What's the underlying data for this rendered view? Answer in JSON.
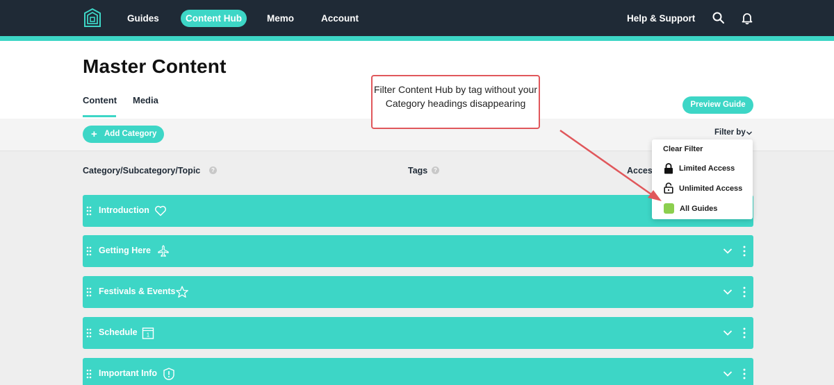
{
  "nav": {
    "logo": "house-logo",
    "items": [
      {
        "label": "Guides"
      },
      {
        "label": "Content Hub"
      },
      {
        "label": "Memo"
      },
      {
        "label": "Account"
      }
    ],
    "help_label": "Help & Support",
    "search_icon": "search-icon",
    "bell_icon": "bell-icon",
    "accent_color": "#3dd6c6",
    "bg_color": "#1f2a36"
  },
  "page": {
    "title": "Master Content",
    "tabs": [
      {
        "label": "Content"
      },
      {
        "label": "Media"
      }
    ],
    "preview_button": "Preview Guide"
  },
  "toolbar": {
    "add_category": "+ Add Category",
    "add_category_text": "Add Category",
    "filter_by": "Filter by"
  },
  "columns": {
    "category": "Category/Subcategory/Topic",
    "tags": "Tags",
    "access": "Acces"
  },
  "categories": [
    {
      "label": "Introduction",
      "icon": "heart-icon"
    },
    {
      "label": "Getting Here",
      "icon": "airplane-icon"
    },
    {
      "label": "Festivals & Events",
      "icon": "star-icon"
    },
    {
      "label": "Schedule",
      "icon": "calendar-icon"
    },
    {
      "label": "Important Info",
      "icon": "alert-icon"
    }
  ],
  "filter_menu": {
    "clear": "Clear Filter",
    "options": [
      {
        "label": "Limited Access",
        "icon": "lock-closed-icon"
      },
      {
        "label": "Unlimited Access",
        "icon": "lock-open-icon"
      },
      {
        "label": "All Guides",
        "icon": "green-swatch",
        "color": "#8ccf4f"
      }
    ]
  },
  "annotation": {
    "text": "Filter Content Hub by tag without your Category headings disappearing",
    "color": "#e0575b"
  }
}
